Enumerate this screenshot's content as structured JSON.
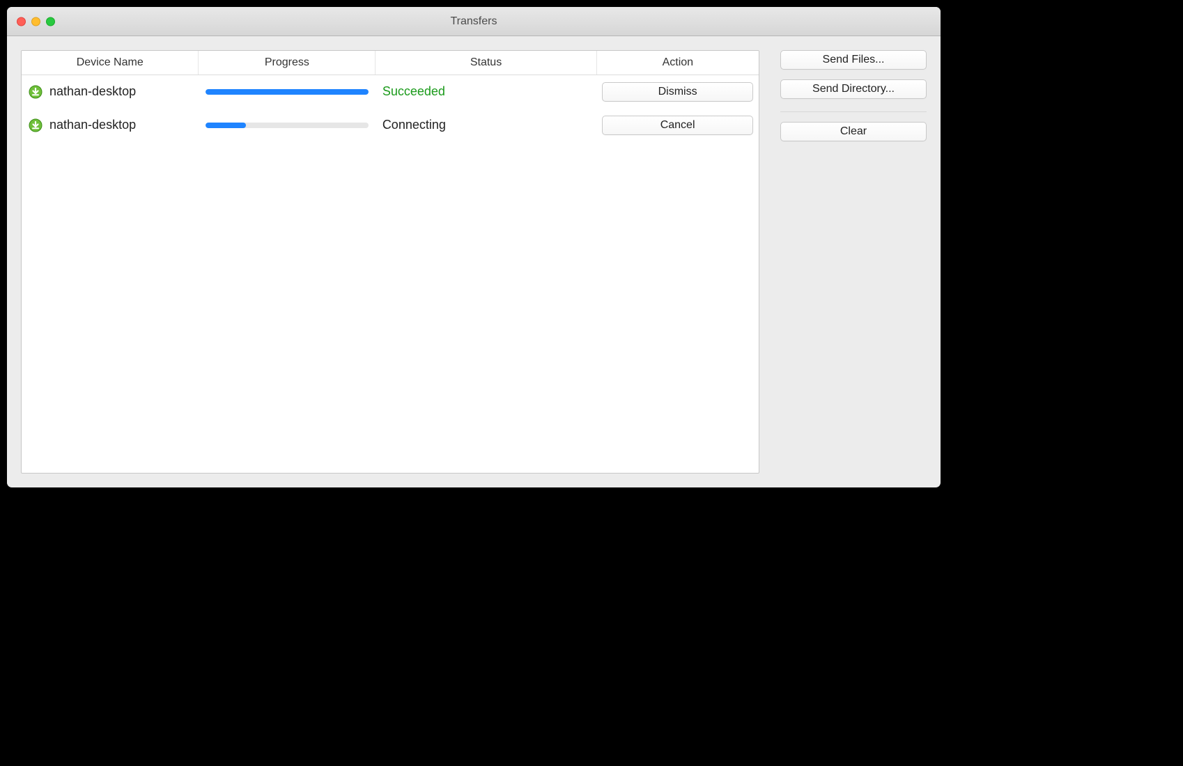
{
  "window": {
    "title": "Transfers"
  },
  "columns": {
    "device": "Device Name",
    "progress": "Progress",
    "status": "Status",
    "action": "Action"
  },
  "transfers": [
    {
      "device": "nathan-desktop",
      "progress_pct": 100,
      "status_label": "Succeeded",
      "status_class": "status-succeeded",
      "action_label": "Dismiss"
    },
    {
      "device": "nathan-desktop",
      "progress_pct": 25,
      "status_label": "Connecting",
      "status_class": "status-default",
      "action_label": "Cancel"
    }
  ],
  "sidebar": {
    "send_files_label": "Send Files...",
    "send_directory_label": "Send Directory...",
    "clear_label": "Clear"
  },
  "icons": {
    "transfer": "download-arrow-icon"
  },
  "colors": {
    "accent_blue": "#1f84ff",
    "success_green": "#1a9a1a"
  }
}
